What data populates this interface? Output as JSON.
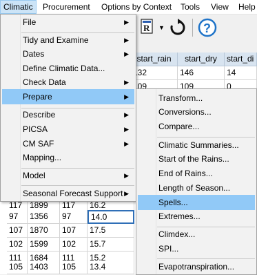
{
  "menubar": [
    "Climatic",
    "Procurement",
    "Options by Context",
    "Tools",
    "View",
    "Help"
  ],
  "grid": {
    "headers": [
      "start_rain",
      "start_dry",
      "start_di"
    ],
    "top_rows": [
      [
        "132",
        "146",
        "14"
      ],
      [
        "109",
        "109",
        "0"
      ]
    ],
    "rows": [
      [
        "117",
        "1899",
        "117",
        "16.2"
      ],
      [
        "97",
        "1356",
        "97",
        "14.0"
      ],
      [
        "107",
        "1870",
        "107",
        "17.5"
      ],
      [
        "102",
        "1599",
        "102",
        "15.7"
      ],
      [
        "111",
        "1684",
        "111",
        "15.2"
      ],
      [
        "105",
        "1403",
        "105",
        "13.4"
      ]
    ]
  },
  "climatic_menu": {
    "items": [
      {
        "label": "File",
        "submenu": true
      },
      {
        "label": "Tidy and Examine",
        "submenu": true
      },
      {
        "label": "Dates",
        "submenu": true
      },
      {
        "label": "Define Climatic Data...",
        "submenu": false
      },
      {
        "label": "Check Data",
        "submenu": true
      },
      {
        "label": "Prepare",
        "submenu": true
      },
      {
        "label": "Describe",
        "submenu": true
      },
      {
        "label": "PICSA",
        "submenu": true
      },
      {
        "label": "CM SAF",
        "submenu": true
      },
      {
        "label": "Mapping...",
        "submenu": false
      },
      {
        "label": "Model",
        "submenu": true
      },
      {
        "label": "Seasonal Forecast Support",
        "submenu": true
      }
    ]
  },
  "prepare_menu": {
    "items": [
      "Transform...",
      "Conversions...",
      "Compare...",
      "Climatic Summaries...",
      "Start of the Rains...",
      "End of Rains...",
      "Length of Season...",
      "Spells...",
      "Extremes...",
      "Climdex...",
      "SPI...",
      "Evapotranspiration..."
    ]
  },
  "colors": {
    "highlight": "#91c9f7",
    "help_blue": "#1e73c8"
  }
}
